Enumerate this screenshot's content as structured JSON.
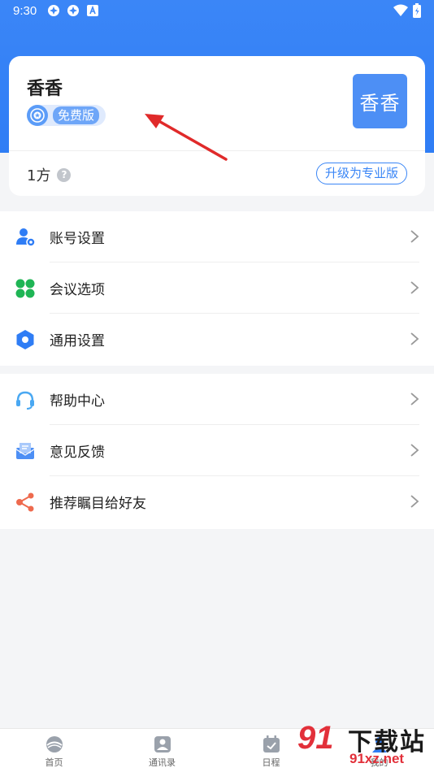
{
  "status_bar": {
    "time": "9:30",
    "icons": [
      "app-notification-icon",
      "app-notification-icon",
      "a-icon"
    ],
    "right_icons": [
      "wifi-icon",
      "battery-icon"
    ]
  },
  "profile": {
    "name": "香香",
    "plan": "免费版",
    "avatar_text": "香香",
    "capacity": "1方",
    "help_symbol": "?",
    "upgrade_label": "升级为专业版"
  },
  "menu_group_1": [
    {
      "label": "账号设置",
      "icon": "account-settings-icon",
      "color": "#2f7df5"
    },
    {
      "label": "会议选项",
      "icon": "meeting-options-icon",
      "color": "#1fb555"
    },
    {
      "label": "通用设置",
      "icon": "general-settings-icon",
      "color": "#2f7df5"
    }
  ],
  "menu_group_2": [
    {
      "label": "帮助中心",
      "icon": "headset-icon",
      "color": "#4aa8f2"
    },
    {
      "label": "意见反馈",
      "icon": "feedback-mail-icon",
      "color": "#4d8ff5"
    },
    {
      "label": "推荐瞩目给好友",
      "icon": "share-icon",
      "color": "#ee6a4e"
    }
  ],
  "tabbar": {
    "home": "首页",
    "contacts": "通讯录",
    "schedule": "日程",
    "me": "我的"
  },
  "watermark": {
    "logo": "91",
    "text": "下载站",
    "url": "91xz.net"
  },
  "colors": {
    "brand": "#3b86f7",
    "background": "#f4f5f7",
    "arrow": "#e02a2a"
  }
}
